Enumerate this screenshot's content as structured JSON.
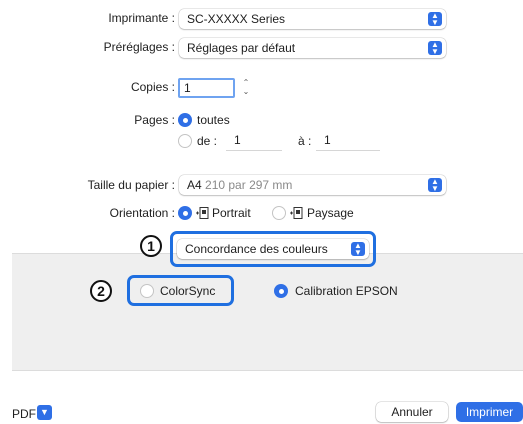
{
  "printer": {
    "label": "Imprimante :",
    "value": "SC-XXXXX Series"
  },
  "presets": {
    "label": "Préréglages :",
    "value": "Réglages par défaut"
  },
  "copies": {
    "label": "Copies :",
    "value": "1"
  },
  "pages": {
    "label": "Pages :",
    "all_label": "toutes",
    "from_label": "de :",
    "from_value": "1",
    "to_label": "à :",
    "to_value": "1"
  },
  "paper_size": {
    "label": "Taille du papier :",
    "value_main": "A4",
    "value_detail": "210 par 297 mm"
  },
  "orientation": {
    "label": "Orientation :",
    "portrait_label": "Portrait",
    "landscape_label": "Paysage"
  },
  "section_popup": {
    "value": "Concordance des couleurs"
  },
  "color_options": {
    "colorsync_label": "ColorSync",
    "epson_label": "Calibration EPSON"
  },
  "callouts": {
    "one": "1",
    "two": "2"
  },
  "footer": {
    "pdf_label": "PDF",
    "cancel_label": "Annuler",
    "print_label": "Imprimer"
  },
  "colors": {
    "accent": "#2f6fe6",
    "highlight": "#1f6fe0",
    "panel": "#efefef"
  }
}
